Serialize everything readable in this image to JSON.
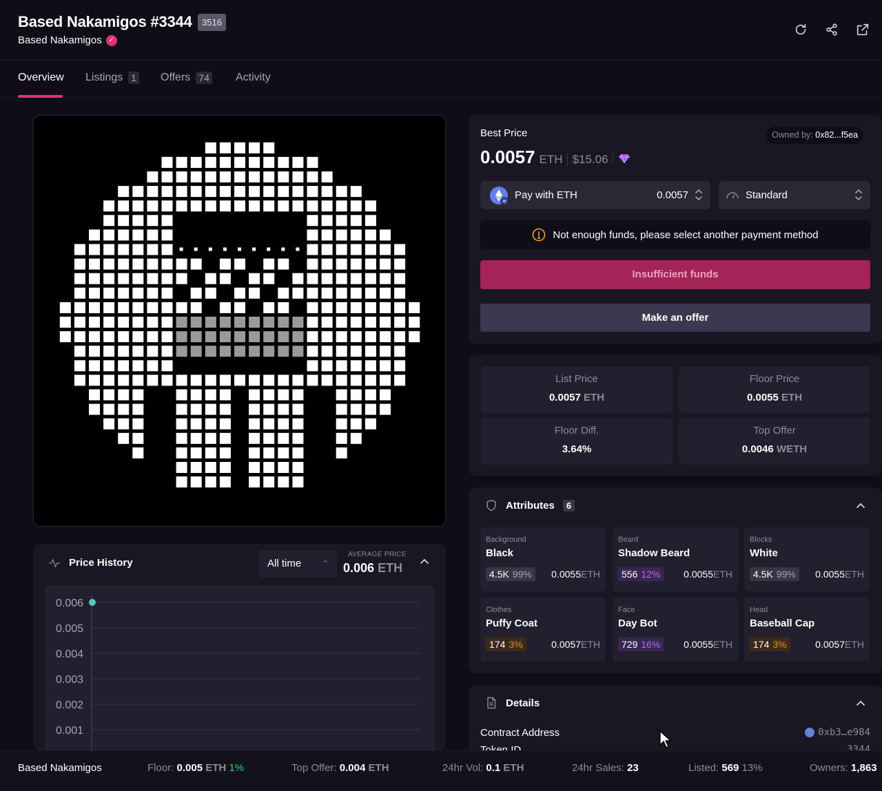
{
  "header": {
    "title": "Based Nakamigos #3344",
    "rank": "3516",
    "collection": "Based Nakamigos"
  },
  "tabs": [
    {
      "label": "Overview",
      "count": null
    },
    {
      "label": "Listings",
      "count": "1"
    },
    {
      "label": "Offers",
      "count": "74"
    },
    {
      "label": "Activity",
      "count": null
    }
  ],
  "price_history": {
    "title": "Price History",
    "range": "All time",
    "avg_label": "AVERAGE PRICE",
    "avg_value": "0.006",
    "avg_unit": "ETH",
    "y_ticks": [
      "0.006",
      "0.005",
      "0.004",
      "0.003",
      "0.002",
      "0.001"
    ]
  },
  "chart_data": {
    "type": "scatter",
    "title": "",
    "xlabel": "",
    "ylabel": "",
    "y_ticks": [
      0.006,
      0.005,
      0.004,
      0.003,
      0.002,
      0.001
    ],
    "points": [
      {
        "y": 0.006
      }
    ],
    "grid": true,
    "colors": {
      "point": "#5ec3c6"
    }
  },
  "buy": {
    "best_price_label": "Best Price",
    "owned_label": "Owned by:",
    "owner": "0x82...f5ea",
    "price": "0.0057",
    "unit": "ETH",
    "usd": "$15.06",
    "pay_label": "Pay with ETH",
    "pay_value": "0.0057",
    "speed": "Standard",
    "warning": "Not enough funds, please select another payment method",
    "insufficient": "Insufficient funds",
    "make_offer": "Make an offer"
  },
  "stats": [
    {
      "label": "List Price",
      "value": "0.0057",
      "unit": "ETH"
    },
    {
      "label": "Floor Price",
      "value": "0.0055",
      "unit": "ETH"
    },
    {
      "label": "Floor Diff.",
      "value": "3.64%",
      "unit": ""
    },
    {
      "label": "Top Offer",
      "value": "0.0046",
      "unit": "WETH"
    }
  ],
  "attributes": {
    "title": "Attributes",
    "count": "6",
    "items": [
      {
        "type": "Background",
        "value": "Black",
        "count": "4.5K",
        "pct": "99%",
        "price": "0.0055",
        "unit": "ETH",
        "tone": "grey"
      },
      {
        "type": "Beard",
        "value": "Shadow Beard",
        "count": "556",
        "pct": "12%",
        "price": "0.0055",
        "unit": "ETH",
        "tone": "purple"
      },
      {
        "type": "Blocks",
        "value": "White",
        "count": "4.5K",
        "pct": "99%",
        "price": "0.0055",
        "unit": "ETH",
        "tone": "grey"
      },
      {
        "type": "Clothes",
        "value": "Puffy Coat",
        "count": "174",
        "pct": "3%",
        "price": "0.0057",
        "unit": "ETH",
        "tone": "orange"
      },
      {
        "type": "Face",
        "value": "Day Bot",
        "count": "729",
        "pct": "16%",
        "price": "0.0055",
        "unit": "ETH",
        "tone": "purple"
      },
      {
        "type": "Head",
        "value": "Baseball Cap",
        "count": "174",
        "pct": "3%",
        "price": "0.0057",
        "unit": "ETH",
        "tone": "orange"
      }
    ]
  },
  "details": {
    "title": "Details",
    "contract_label": "Contract Address",
    "contract_value": "0xb3…e984",
    "token_label": "Token ID",
    "token_value": "3344"
  },
  "footer": {
    "collection": "Based Nakamigos",
    "floor_label": "Floor:",
    "floor_value": "0.005",
    "floor_unit": "ETH",
    "floor_change": "1%",
    "top_offer_label": "Top Offer:",
    "top_offer_value": "0.004",
    "top_offer_unit": "ETH",
    "vol_label": "24hr Vol:",
    "vol_value": "0.1",
    "vol_unit": "ETH",
    "sales_label": "24hr Sales:",
    "sales_value": "23",
    "listed_label": "Listed:",
    "listed_value": "569",
    "listed_pct": "13%",
    "owners_label": "Owners:",
    "owners_value": "1,863"
  }
}
